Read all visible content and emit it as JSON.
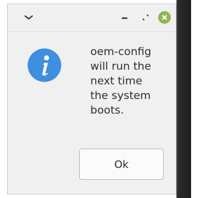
{
  "dialog": {
    "message": "oem-config\nwill run the\nnext time\nthe system\nboots.",
    "ok_label": "Ok",
    "icon": "info-icon"
  },
  "titlebar": {
    "icons": [
      "chevron-down-icon",
      "minimize-icon",
      "maximize-icon",
      "close-icon"
    ],
    "close_color": "#8fb651"
  },
  "colors": {
    "info_icon": "#3f8fe0",
    "window_bg": "#f0f0f0"
  }
}
